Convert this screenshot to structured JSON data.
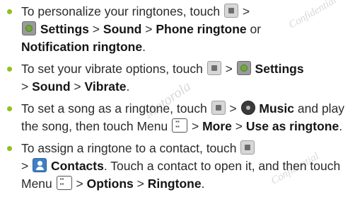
{
  "watermark": {
    "lines": [
      "Confidential",
      "Motorola",
      "Confidential"
    ]
  },
  "bullets": [
    {
      "t1": "To personalize your ringtones, touch",
      "t2": ">",
      "settings": "Settings",
      "gt1": ">",
      "sound": "Sound",
      "gt2": ">",
      "phone_ringtone": "Phone ringtone",
      "or": "or",
      "notification_ringtone": "Notification ringtone",
      "end": "."
    },
    {
      "t1": "To set your vibrate options, touch",
      "gt1": ">",
      "settings": "Settings",
      "gt2": ">",
      "sound": "Sound",
      "gt3": ">",
      "vibrate": "Vibrate",
      "end": "."
    },
    {
      "t1": "To set a song as a ringtone, touch",
      "gt1": ">",
      "music": "Music",
      "and": "and play the song, then touch Menu",
      "gt2": ">",
      "more": "More",
      "gt3": ">",
      "use_as_ringtone": "Use as ringtone",
      "end": "."
    },
    {
      "t1": "To assign a ringtone to a contact, touch",
      "gt1": ">",
      "contacts": "Contacts",
      "t2": ". Touch a contact to open it, and then touch Menu",
      "gt2": ">",
      "options": "Options",
      "gt3": ">",
      "ringtone": "Ringtone",
      "end": "."
    }
  ],
  "icons": {
    "home": "home-screen-icon",
    "settings": "settings-icon",
    "music": "music-icon",
    "menu": "menu-key-icon",
    "contacts": "contacts-icon"
  }
}
